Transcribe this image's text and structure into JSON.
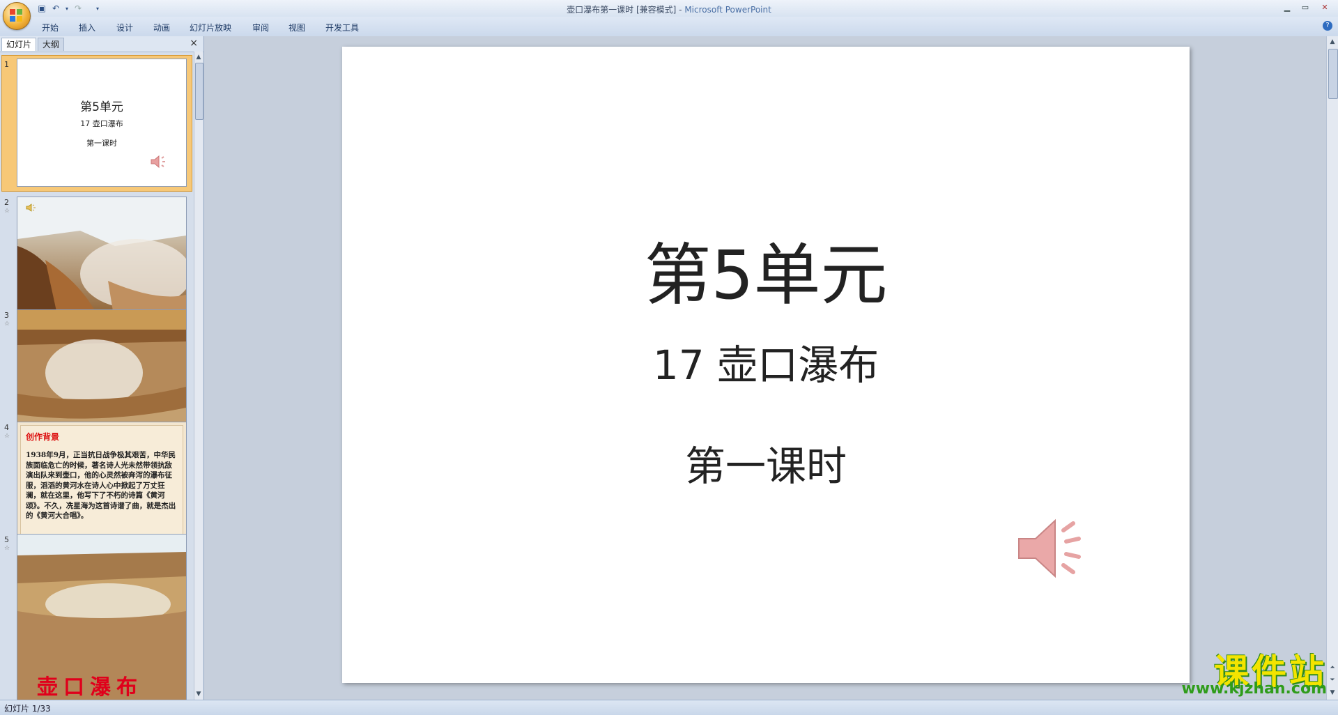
{
  "window": {
    "title_doc": "壶口瀑布第一课时 [兼容模式]",
    "title_sep": " - ",
    "title_app": "Microsoft PowerPoint"
  },
  "ribbon": {
    "tabs": [
      "开始",
      "插入",
      "设计",
      "动画",
      "幻灯片放映",
      "审阅",
      "视图",
      "开发工具"
    ]
  },
  "left_pane": {
    "tabs": [
      "幻灯片",
      "大纲"
    ],
    "close": "×",
    "thumbnails": [
      {
        "num": "1",
        "title": "第5单元",
        "subtitle": "17  壶口瀑布",
        "lesson": "第一课时"
      },
      {
        "num": "2"
      },
      {
        "num": "3"
      },
      {
        "num": "4",
        "heading": "创作背景",
        "body": "1938年9月，正当抗日战争极其艰苦，中华民族面临危亡的时候，著名诗人光未然带领抗敌演出队来到壶口，他的心灵然被奔泻的瀑布征服，滔滔的黄河水在诗人心中掀起了万丈狂澜，就在这里，他写下了不朽的诗篇《黄河颂》。不久，冼星海为这首诗谱了曲，就是杰出的《黄河大合唱》。"
      },
      {
        "num": "5",
        "overlay": "壶口瀑布"
      }
    ]
  },
  "slide": {
    "title": "第5单元",
    "subtitle": "17  壶口瀑布",
    "lesson": "第一课时",
    "icon": "speaker-icon"
  },
  "statusbar": {
    "text": "幻灯片 1/33"
  },
  "watermark": {
    "big": "课件站",
    "url": "www.kjzhan.com"
  },
  "colors": {
    "accent": "#f7c877",
    "ribbon": "#dfe8f5",
    "heading_red": "#d11111",
    "watermark_yellow": "#f3e400",
    "watermark_green": "#2f9c1a"
  }
}
